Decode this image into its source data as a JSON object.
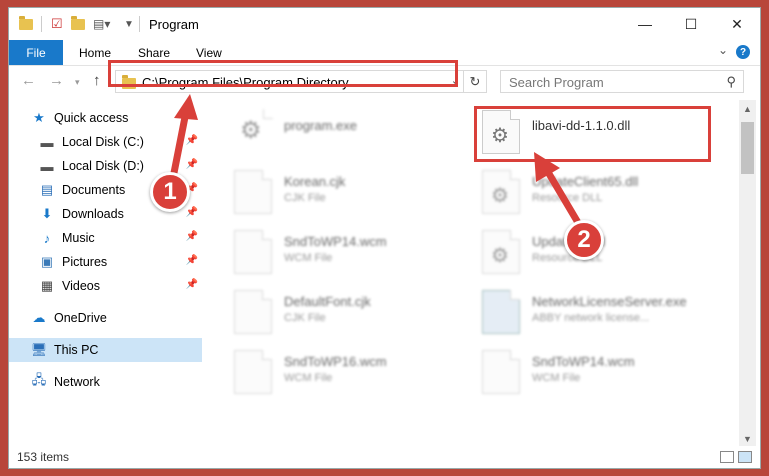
{
  "window": {
    "title": "Program",
    "controls": {
      "minimize": "—",
      "maximize": "☐",
      "close": "✕"
    }
  },
  "ribbon": {
    "tabs": [
      "File",
      "Home",
      "Share",
      "View"
    ],
    "help_label": "?"
  },
  "nav": {
    "address": "C:\\Program Files\\Program Directory",
    "search_placeholder": "Search Program"
  },
  "sidebar": {
    "items": [
      {
        "label": "Quick access",
        "icon": "star-icon",
        "pinned": false
      },
      {
        "label": "Local Disk (C:)",
        "icon": "drive-icon",
        "pinned": true
      },
      {
        "label": "Local Disk (D:)",
        "icon": "drive-icon",
        "pinned": true
      },
      {
        "label": "Documents",
        "icon": "documents-icon",
        "pinned": true
      },
      {
        "label": "Downloads",
        "icon": "download-icon",
        "pinned": true
      },
      {
        "label": "Music",
        "icon": "music-icon",
        "pinned": true
      },
      {
        "label": "Pictures",
        "icon": "pictures-icon",
        "pinned": true
      },
      {
        "label": "Videos",
        "icon": "videos-icon",
        "pinned": true
      },
      {
        "label": "OneDrive",
        "icon": "cloud-icon",
        "pinned": false
      },
      {
        "label": "This PC",
        "icon": "computer-icon",
        "pinned": false,
        "selected": true
      },
      {
        "label": "Network",
        "icon": "network-icon",
        "pinned": false
      }
    ]
  },
  "files": [
    {
      "name": "program.exe",
      "type": ""
    },
    {
      "name": "libavi-dd-1.1.0.dll",
      "type": ""
    },
    {
      "name": "Korean.cjk",
      "type": "CJK File"
    },
    {
      "name": "UpdateClient65.dll",
      "type": "Resource DLL"
    },
    {
      "name": "SndToWP14.wcm",
      "type": "WCM File"
    },
    {
      "name": "Update25.dll",
      "type": "Resource DLL"
    },
    {
      "name": "DefaultFont.cjk",
      "type": "CJK File"
    },
    {
      "name": "NetworkLicenseServer.exe",
      "type": "ABBY network license..."
    },
    {
      "name": "SndToWP16.wcm",
      "type": "WCM File"
    },
    {
      "name": "SndToWP14.wcm",
      "type": "WCM File"
    }
  ],
  "status": {
    "item_count": "153 items"
  },
  "callouts": {
    "one": "1",
    "two": "2"
  },
  "colors": {
    "accent": "#1979ca",
    "highlight": "#d9403a",
    "selected": "#cce4f7"
  }
}
